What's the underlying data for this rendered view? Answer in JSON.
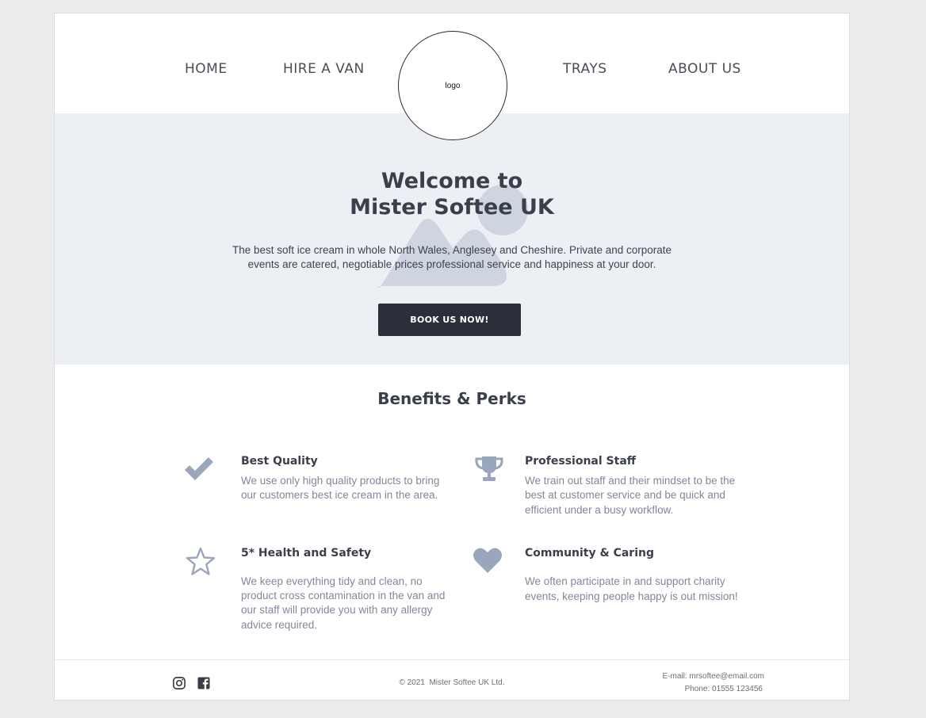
{
  "nav": {
    "links": [
      "HOME",
      "HIRE A VAN",
      "TRAYS",
      "ABOUT US"
    ],
    "logo_text": "logo"
  },
  "hero": {
    "title_line1": "Welcome to",
    "title_line2": "Mister Softee UK",
    "description_line1": "The best soft ice cream in whole North Wales, Anglesey and Cheshire. Private and corporate",
    "description_line2": "events are catered, negotiable prices professional service and happiness at your door.",
    "cta_label": "BOOK US NOW!",
    "background_icon": "image-placeholder-icon"
  },
  "benefits": {
    "title": "Benefits & Perks",
    "items": [
      {
        "icon": "check-icon",
        "title": "Best Quality",
        "lines": [
          "We use only high quality products to bring",
          "our customers best ice cream in the area."
        ]
      },
      {
        "icon": "trophy-icon",
        "title": "Professional Staff",
        "lines": [
          "We train out staff and their mindset to be the",
          "best at customer service and be quick and",
          "efficient under a busy workflow."
        ]
      },
      {
        "icon": "star-icon",
        "title": "5* Health and Safety",
        "lines": [
          "We keep everything tidy and clean, no",
          "product cross contamination in the van and",
          "our staff will provide you with any allergy",
          "advice required."
        ]
      },
      {
        "icon": "heart-icon",
        "title": "Community & Caring",
        "lines": [
          "We often participate in and support charity",
          "events, keeping people happy is out mission!"
        ]
      }
    ]
  },
  "footer": {
    "social": [
      "instagram-icon",
      "facebook-icon"
    ],
    "copyright": "© 2021  Mister Softee UK Ltd.",
    "email": "E-mail: mrsoftee@email.com",
    "phone": "Phone: 01555 123456"
  },
  "colors": {
    "hero_background": "#eceff4",
    "text_dark": "#3b3f4c",
    "text_muted": "#818899",
    "icon_color": "#9aa6bc",
    "button_background": "#2c2f3a"
  }
}
